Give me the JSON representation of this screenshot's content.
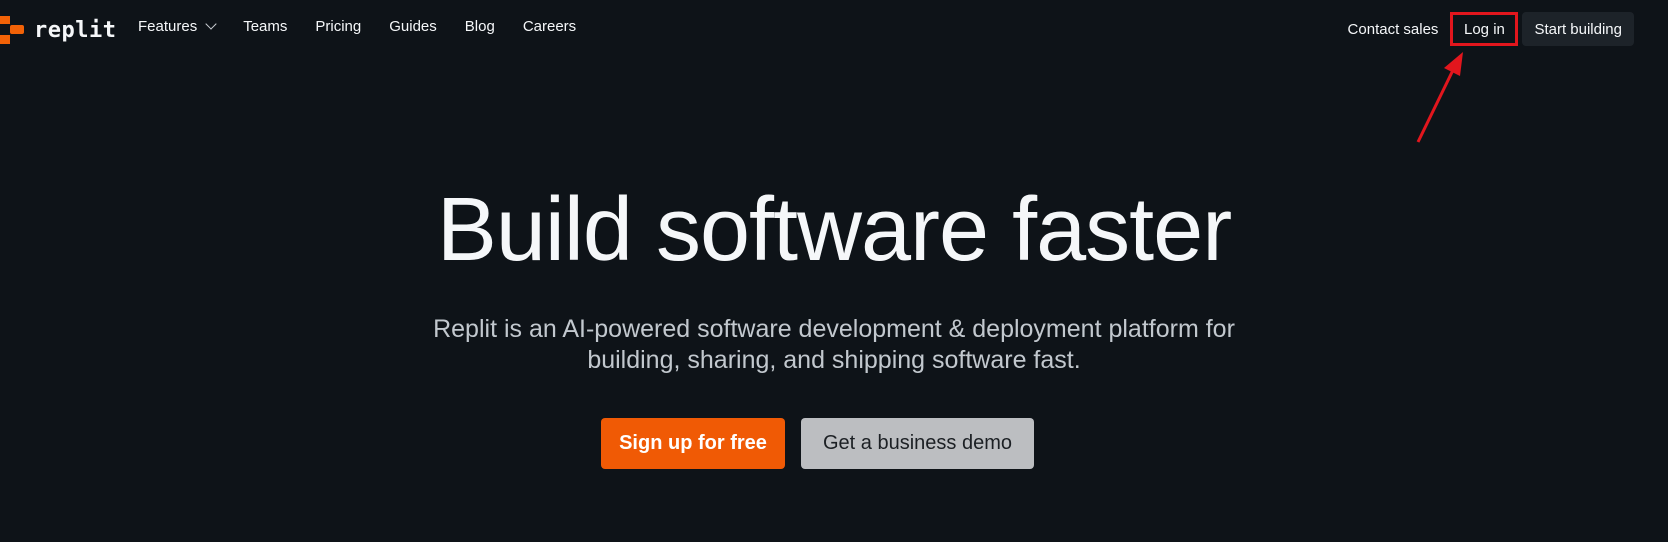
{
  "brand": {
    "logo_text": "replit",
    "accent_color": "#f26207"
  },
  "nav": {
    "links": [
      {
        "label": "Features",
        "has_dropdown": true
      },
      {
        "label": "Teams"
      },
      {
        "label": "Pricing"
      },
      {
        "label": "Guides"
      },
      {
        "label": "Blog"
      },
      {
        "label": "Careers"
      }
    ],
    "contact_label": "Contact sales",
    "login_label": "Log in",
    "start_label": "Start building"
  },
  "annotation": {
    "highlight_color": "#e2161d",
    "icon": "arrow-icon"
  },
  "hero": {
    "title": "Build software faster",
    "subtitle_line1": "Replit is an AI-powered software development & deployment platform for",
    "subtitle_line2": "building, sharing, and shipping software fast."
  },
  "cta": {
    "signup_label": "Sign up for free",
    "demo_label": "Get a business demo",
    "signup_color": "#f05a05",
    "demo_color": "#bcbec1"
  }
}
